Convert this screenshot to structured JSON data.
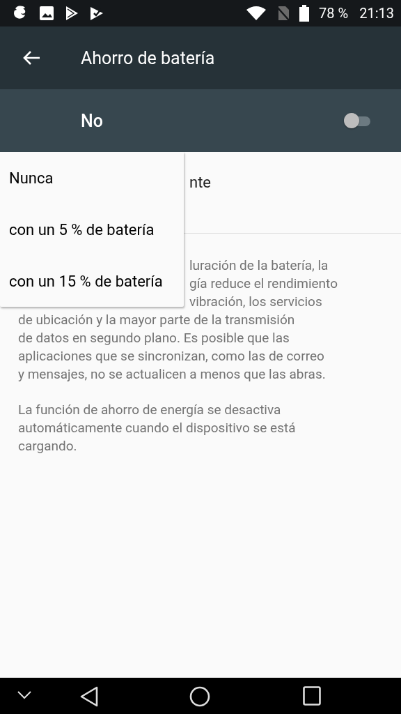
{
  "status_bar": {
    "battery": "78 %",
    "time": "21:13"
  },
  "toolbar": {
    "title": "Ahorro de batería"
  },
  "master_switch": {
    "label": "No",
    "on": false
  },
  "setting": {
    "title_fragment": "nte"
  },
  "description": [
    {
      "text": "luración de la batería, la",
      "covered": true
    },
    {
      "text": "gía reduce el rendimiento",
      "covered": true
    },
    {
      "text": "vibración, los servicios",
      "covered": true
    },
    {
      "text": "de ubicación y la mayor parte de la transmisión",
      "covered": false
    },
    {
      "text": "de datos en segundo plano. Es posible que las",
      "covered": false
    },
    {
      "text": "aplicaciones que se sincronizan, como las de correo",
      "covered": false
    },
    {
      "text": "y mensajes, no se actualicen a menos que las abras.",
      "covered": false
    }
  ],
  "note": "La función de ahorro de energía se desactiva automáticamente cuando el dispositivo se está cargando.",
  "menu": [
    "Nunca",
    "con un 5 % de batería",
    "con un 15 % de batería"
  ]
}
